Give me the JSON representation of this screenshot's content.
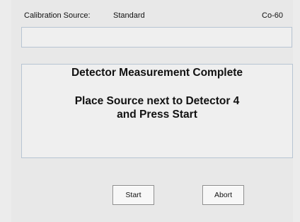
{
  "header": {
    "source_label": "Calibration Source:",
    "source_value": "Standard",
    "isotope": "Co-60"
  },
  "status": {
    "text": ""
  },
  "message": {
    "title": "Detector Measurement Complete",
    "line1": "Place Source next to Detector 4",
    "line2": "and Press Start"
  },
  "buttons": {
    "start": "Start",
    "abort": "Abort"
  }
}
